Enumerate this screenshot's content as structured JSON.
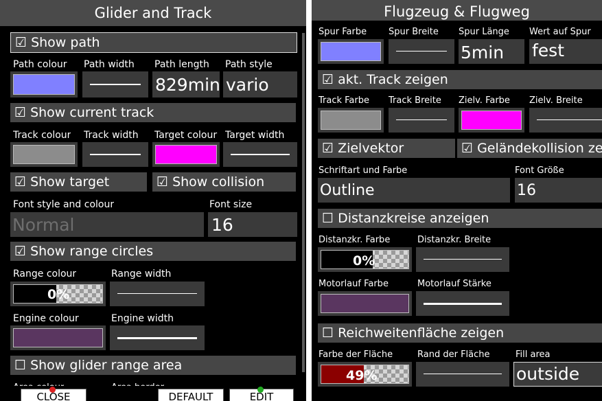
{
  "left": {
    "title": "Glider and Track",
    "show_path": "☑ Show path",
    "path_colour_label": "Path colour",
    "path_width_label": "Path width",
    "path_length_label": "Path length",
    "path_style_label": "Path style",
    "path_length_value": "829min",
    "path_style_value": "vario",
    "path_colour": "#8080ff",
    "show_current_track": "☑ Show current track",
    "track_colour_label": "Track colour",
    "track_width_label": "Track width",
    "target_colour_label": "Target colour",
    "target_width_label": "Target width",
    "track_colour": "#8c8c8c",
    "target_colour": "#ff00ff",
    "show_target": "☑ Show target",
    "show_collision": "☑ Show collision",
    "font_style_label": "Font style and colour",
    "font_size_label": "Font size",
    "font_style_value": "Normal",
    "font_size_value": "16",
    "show_range_circles": "☑ Show range circles",
    "range_colour_label": "Range colour",
    "range_width_label": "Range width",
    "range_pct": "0%",
    "range_fill": 0,
    "engine_colour_label": "Engine colour",
    "engine_width_label": "Engine width",
    "engine_colour": "#5a3660",
    "show_glider_range": "☐ Show glider range area",
    "area_colour_label": "Area colour",
    "area_border_label": "Area border",
    "buttons": {
      "close": "CLOSE",
      "default": "DEFAULT",
      "edit": "EDIT"
    }
  },
  "right": {
    "title": "Flugzeug & Flugweg",
    "spur_farbe_label": "Spur Farbe",
    "spur_breite_label": "Spur Breite",
    "spur_laenge_label": "Spur Länge",
    "wert_label": "Wert auf Spur",
    "spur_laenge_value": "5min",
    "wert_value": "fest",
    "spur_colour": "#8080ff",
    "akt_track": "☑ akt. Track zeigen",
    "track_farbe_label": "Track Farbe",
    "track_breite_label": "Track Breite",
    "zielv_farbe_label": "Zielv. Farbe",
    "zielv_breite_label": "Zielv. Breite",
    "track_colour": "#8c8c8c",
    "zielv_colour": "#ff00ff",
    "zielvektor": "☑ Zielvektor",
    "gelaende": "☑ Geländekollision zeigen",
    "schrift_label": "Schriftart und Farbe",
    "font_groesse_label": "Font Größe",
    "schrift_value": "Outline",
    "font_groesse_value": "16",
    "distanzkreise": "☐ Distanzkreise anzeigen",
    "distanz_farbe_label": "Distanzkr. Farbe",
    "distanz_breite_label": "Distanzkr. Breite",
    "distanz_pct": "0%",
    "distanz_fill": 0,
    "motor_farbe_label": "Motorlauf Farbe",
    "motor_staerke_label": "Motorlauf Stärke",
    "motor_colour": "#5a3660",
    "reichweite": "☐ Reichweitenfläche zeigen",
    "farbe_flaeche_label": "Farbe der Fläche",
    "rand_flaeche_label": "Rand der Fläche",
    "fill_area_label": "Fill area",
    "flaeche_pct": "49%",
    "flaeche_fill": 0.49,
    "flaeche_colour": "#8b0000",
    "fill_area_value": "outside"
  }
}
